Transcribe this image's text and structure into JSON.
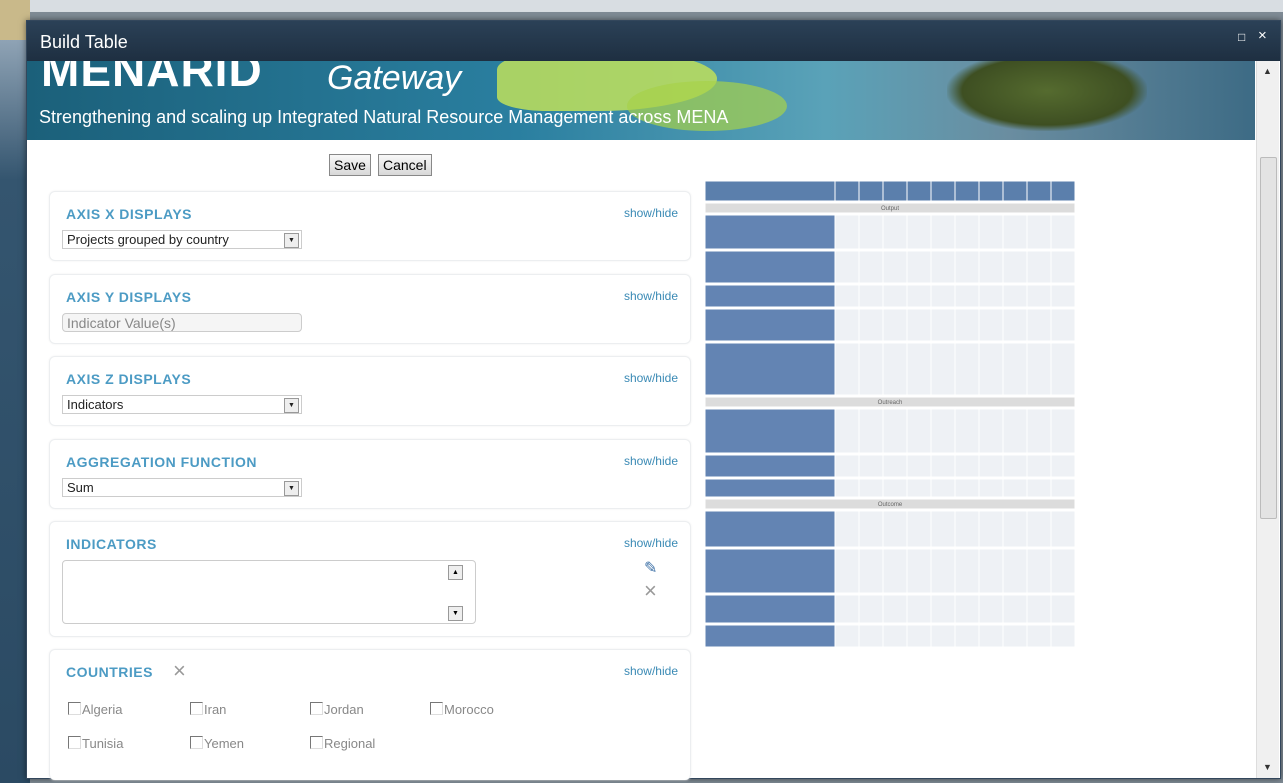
{
  "window": {
    "title": "Build Table",
    "maximize_icon": "□",
    "close_icon": "×"
  },
  "banner": {
    "logo_bold": "MENARID",
    "logo_italic": "Gateway",
    "tagline": "Strengthening and scaling up Integrated Natural Resource Management across MENA"
  },
  "toolbar": {
    "save_label": "Save",
    "cancel_label": "Cancel"
  },
  "panels": {
    "axis_x": {
      "title": "AXIS X DISPLAYS",
      "showhide": "show/hide",
      "selected": "Projects grouped by country"
    },
    "axis_y": {
      "title": "AXIS Y DISPLAYS",
      "showhide": "show/hide",
      "value": "Indicator Value(s)"
    },
    "axis_z": {
      "title": "AXIS Z DISPLAYS",
      "showhide": "show/hide",
      "selected": "Indicators"
    },
    "aggregation": {
      "title": "AGGREGATION FUNCTION",
      "showhide": "show/hide",
      "selected": "Sum"
    },
    "indicators": {
      "title": "INDICATORS",
      "showhide": "show/hide",
      "edit_icon": "✎",
      "remove_icon": "×"
    },
    "countries": {
      "title": "COUNTRIES",
      "remove_icon": "×",
      "showhide": "show/hide",
      "items": [
        "Algeria",
        "Iran",
        "Jordan",
        "Morocco",
        "Tunisia",
        "Yemen",
        "Regional"
      ]
    }
  },
  "preview": {
    "section_labels": [
      "Output",
      "Outreach",
      "Outcome"
    ],
    "columns": 10
  }
}
